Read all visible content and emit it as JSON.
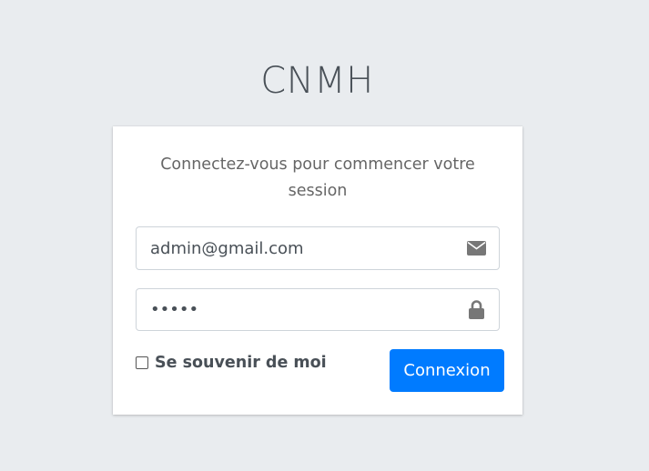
{
  "logo": {
    "text": "CNMH"
  },
  "login": {
    "message": "Connectez-vous pour commencer votre session",
    "email": {
      "value": "admin@gmail.com",
      "icon": "envelope-icon"
    },
    "password": {
      "value": "•••••",
      "icon": "lock-icon"
    },
    "remember_label": "Se souvenir de moi",
    "remember_checked": false,
    "submit_label": "Connexion"
  },
  "colors": {
    "background": "#e9ecef",
    "card": "#ffffff",
    "primary": "#007bff",
    "icon": "#777777"
  }
}
